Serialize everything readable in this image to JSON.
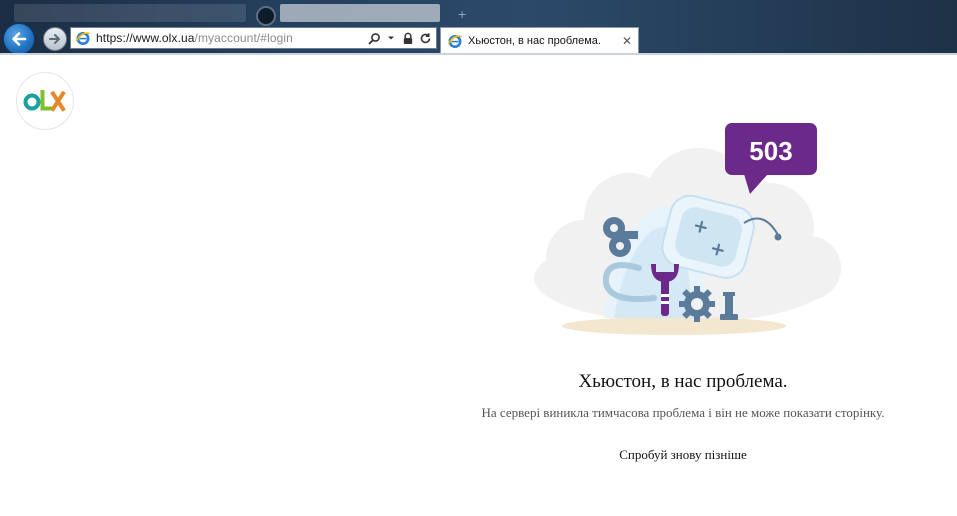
{
  "browser": {
    "address": {
      "url_prefix": "https://www.",
      "url_domain": "olx.ua",
      "url_path": "/myaccount/#login"
    },
    "tab": {
      "title": "Хьюстон, в нас проблема.",
      "close_glyph": "✕"
    },
    "icons": [
      "back-arrow-icon",
      "forward-arrow-icon",
      "ie-logo-icon",
      "search-icon",
      "dropdown-icon",
      "lock-icon",
      "refresh-icon",
      "close-icon"
    ]
  },
  "page": {
    "logo_text": "OLX",
    "error_code": "503",
    "title": "Хьюстон, в нас проблема.",
    "description": "На сервері виникла тимчасова проблема і він не може показати сторінку.",
    "retry_label": "Спробуй знову пізніше"
  },
  "colors": {
    "brand_purple": "#6b2a8a",
    "olx_teal": "#1aa0a0",
    "olx_green": "#7fbf2a",
    "olx_orange": "#e8872a",
    "illustration_blue": "#5a7b9a"
  }
}
